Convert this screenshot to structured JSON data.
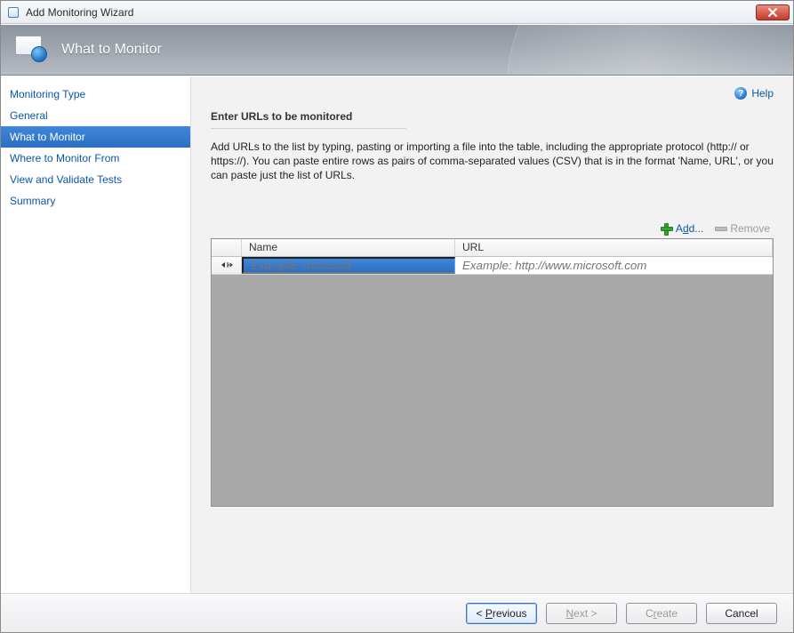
{
  "window": {
    "title": "Add Monitoring Wizard"
  },
  "header": {
    "title": "What to Monitor"
  },
  "sidebar": {
    "items": [
      {
        "label": "Monitoring Type"
      },
      {
        "label": "General"
      },
      {
        "label": "What to Monitor"
      },
      {
        "label": "Where to Monitor From"
      },
      {
        "label": "View and Validate Tests"
      },
      {
        "label": "Summary"
      }
    ],
    "active_index": 2
  },
  "help": {
    "label": "Help"
  },
  "section": {
    "title": "Enter URLs to be monitored",
    "instructions": "Add URLs to the list by typing, pasting or importing a file into the table, including the appropriate protocol (http:// or https://). You can paste entire rows as pairs of comma-separated values (CSV) that is in the format 'Name, URL', or you can paste just the list of URLs."
  },
  "toolbar": {
    "add_prefix": "A",
    "add_underline": "d",
    "add_suffix": "d...",
    "remove_label": "Remove"
  },
  "grid": {
    "columns": {
      "name": "Name",
      "url": "URL"
    },
    "new_row": {
      "name_placeholder": "Example: microsoft",
      "url_placeholder": "Example: http://www.microsoft.com"
    }
  },
  "footer": {
    "previous": {
      "lead": "< ",
      "u": "P",
      "rest": "revious"
    },
    "next": {
      "u": "N",
      "rest": "ext >"
    },
    "create": {
      "lead": "C",
      "u": "r",
      "rest": "eate"
    },
    "cancel": {
      "label": "Cancel"
    }
  }
}
